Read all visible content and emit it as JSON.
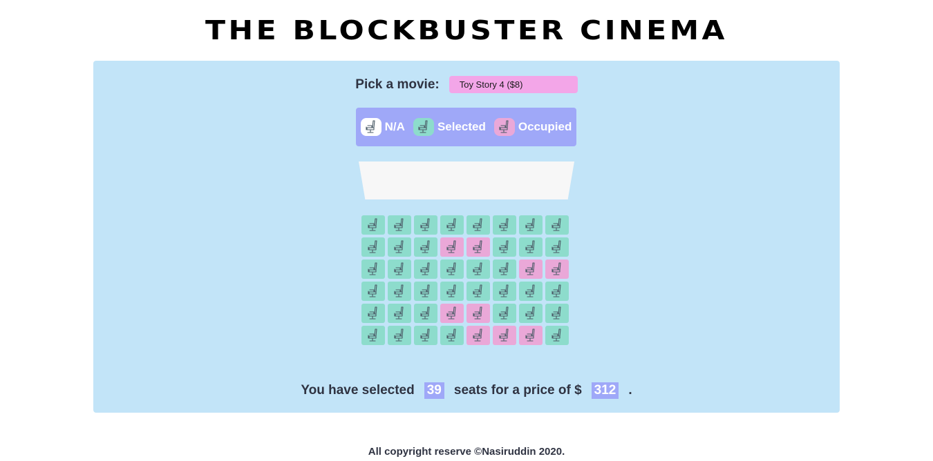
{
  "title": "THE BLOCKBUSTER CINEMA",
  "picker": {
    "label": "Pick a movie:",
    "selected": "Toy Story 4 ($8)"
  },
  "legend": [
    {
      "key": "na",
      "label": "N/A",
      "color": "#ffffff"
    },
    {
      "key": "selected",
      "label": "Selected",
      "color": "#8ddccc"
    },
    {
      "key": "occupied",
      "label": "Occupied",
      "color": "#eaa8d8"
    }
  ],
  "icons": {
    "seat": "seat-icon"
  },
  "seats": [
    [
      "selected",
      "selected",
      "selected",
      "selected",
      "selected",
      "selected",
      "selected",
      "selected"
    ],
    [
      "selected",
      "selected",
      "selected",
      "occupied",
      "occupied",
      "selected",
      "selected",
      "selected"
    ],
    [
      "selected",
      "selected",
      "selected",
      "selected",
      "selected",
      "selected",
      "occupied",
      "occupied"
    ],
    [
      "selected",
      "selected",
      "selected",
      "selected",
      "selected",
      "selected",
      "selected",
      "selected"
    ],
    [
      "selected",
      "selected",
      "selected",
      "occupied",
      "occupied",
      "selected",
      "selected",
      "selected"
    ],
    [
      "selected",
      "selected",
      "selected",
      "selected",
      "occupied",
      "occupied",
      "occupied",
      "selected"
    ]
  ],
  "summary": {
    "prefix": "You have selected",
    "count": "39",
    "middle": "seats for a price of $",
    "price": "312",
    "suffix": "."
  },
  "footer": "All copyright reserve ©Nasiruddin 2020.",
  "colors": {
    "panel": "#c2e4f8",
    "accent": "#9fa8f8",
    "select": "#f3a6e8"
  }
}
